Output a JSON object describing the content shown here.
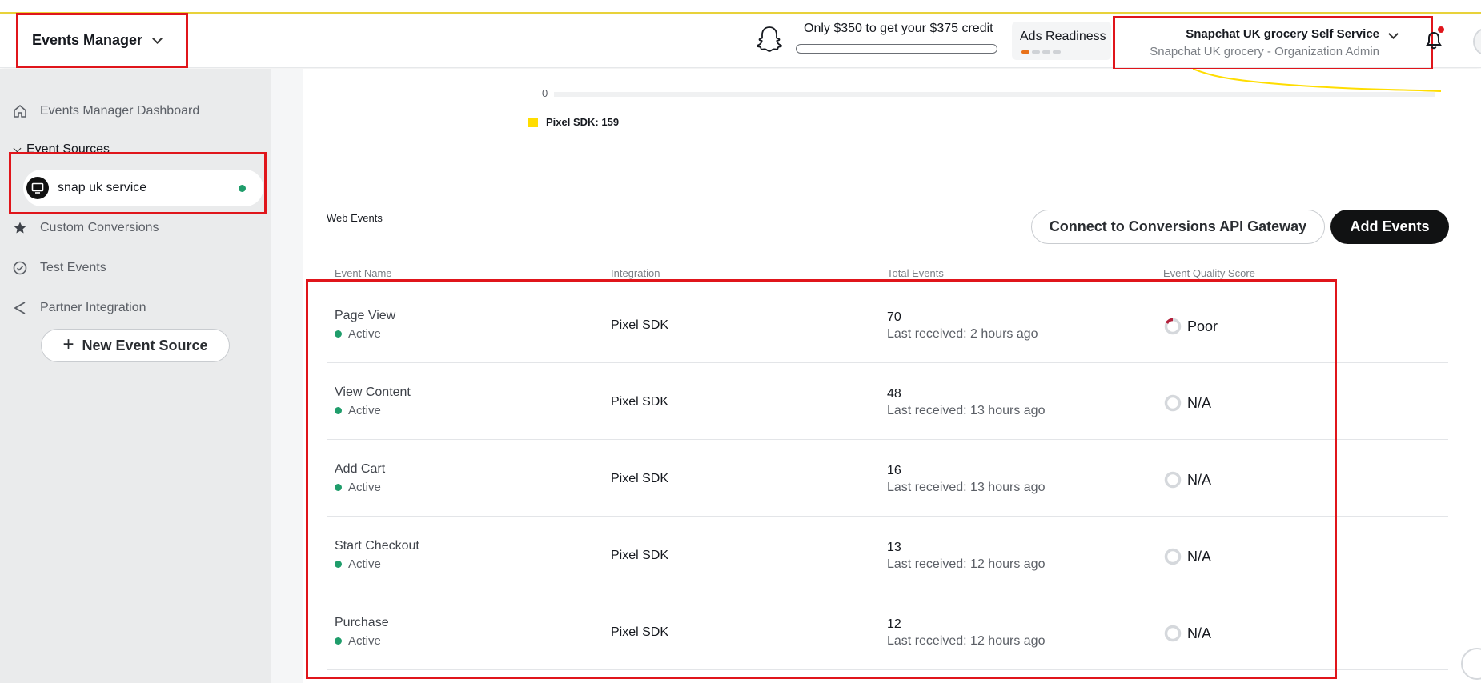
{
  "header": {
    "app_title": "Events Manager",
    "credit_text": "Only $350 to get your $375 credit",
    "ads_readiness_label": "Ads Readiness",
    "account_name": "Snapchat UK grocery Self Service",
    "account_role": "Snapchat UK grocery - Organization Admin"
  },
  "sidebar": {
    "dashboard_label": "Events Manager Dashboard",
    "event_sources_label": "Event Sources",
    "source_name": "snap uk service",
    "custom_conversions_label": "Custom Conversions",
    "test_events_label": "Test Events",
    "partner_integration_label": "Partner Integration",
    "new_source_label": "New Event Source"
  },
  "chart_data": {
    "type": "line",
    "y_tick": "0",
    "legend_entry": "Pixel SDK: 159",
    "series_color": "#ffdd00"
  },
  "web_events": {
    "title": "Web Events",
    "connect_button": "Connect to Conversions API Gateway",
    "add_button": "Add Events",
    "columns": [
      "Event Name",
      "Integration",
      "Total Events",
      "Event Quality Score"
    ],
    "rows": [
      {
        "name": "Page View",
        "status": "Active",
        "integration": "Pixel SDK",
        "total": "70",
        "last": "Last received: 2 hours ago",
        "quality": "Poor"
      },
      {
        "name": "View Content",
        "status": "Active",
        "integration": "Pixel SDK",
        "total": "48",
        "last": "Last received: 13 hours ago",
        "quality": "N/A"
      },
      {
        "name": "Add Cart",
        "status": "Active",
        "integration": "Pixel SDK",
        "total": "16",
        "last": "Last received: 13 hours ago",
        "quality": "N/A"
      },
      {
        "name": "Start Checkout",
        "status": "Active",
        "integration": "Pixel SDK",
        "total": "13",
        "last": "Last received: 12 hours ago",
        "quality": "N/A"
      },
      {
        "name": "Purchase",
        "status": "Active",
        "integration": "Pixel SDK",
        "total": "12",
        "last": "Last received: 12 hours ago",
        "quality": "N/A"
      }
    ]
  },
  "colors": {
    "accent": "#ffdd00",
    "annotation": "#e0151b",
    "active_status": "#1f9d6b",
    "poor_score": "#b3203a"
  }
}
